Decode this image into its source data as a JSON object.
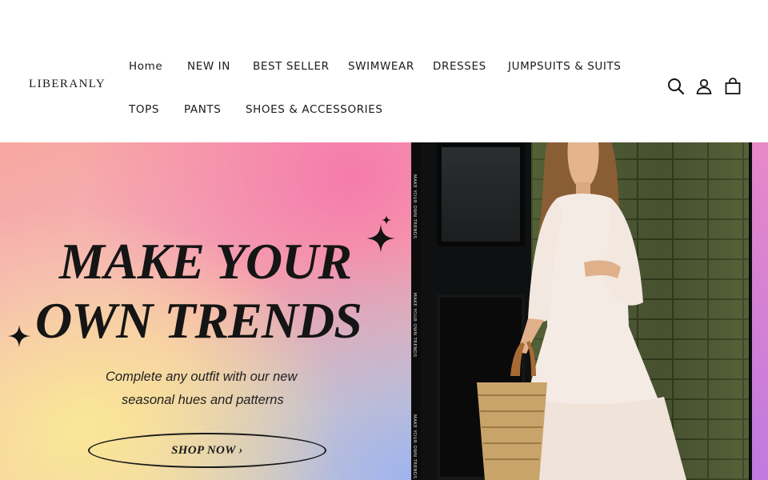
{
  "header": {
    "logo": "LIBERANLY",
    "nav": [
      {
        "label": "Home"
      },
      {
        "label": "NEW IN"
      },
      {
        "label": "BEST SELLER"
      },
      {
        "label": "SWIMWEAR"
      },
      {
        "label": "DRESSES"
      },
      {
        "label": "JUMPSUITS & SUITS"
      },
      {
        "label": "TOPS"
      },
      {
        "label": "PANTS"
      },
      {
        "label": "SHOES & ACCESSORIES"
      }
    ],
    "icons": {
      "search": "search-icon",
      "account": "account-icon",
      "cart": "cart-icon"
    }
  },
  "hero": {
    "headline_line1": "MAKE YOUR",
    "headline_line2": "OWN TRENDS",
    "subtitle_line1": "Complete any outfit with our new",
    "subtitle_line2": "seasonal hues and patterns",
    "cta_label": "SHOP NOW ›",
    "strip_text": "MAKE YOUR OWN TRENDS"
  },
  "colors": {
    "text": "#121212",
    "background": "#ffffff",
    "gradient_pink": "#f4a0c0",
    "gradient_yellow": "#f5e39a",
    "gradient_blue": "#a8b8f0"
  }
}
